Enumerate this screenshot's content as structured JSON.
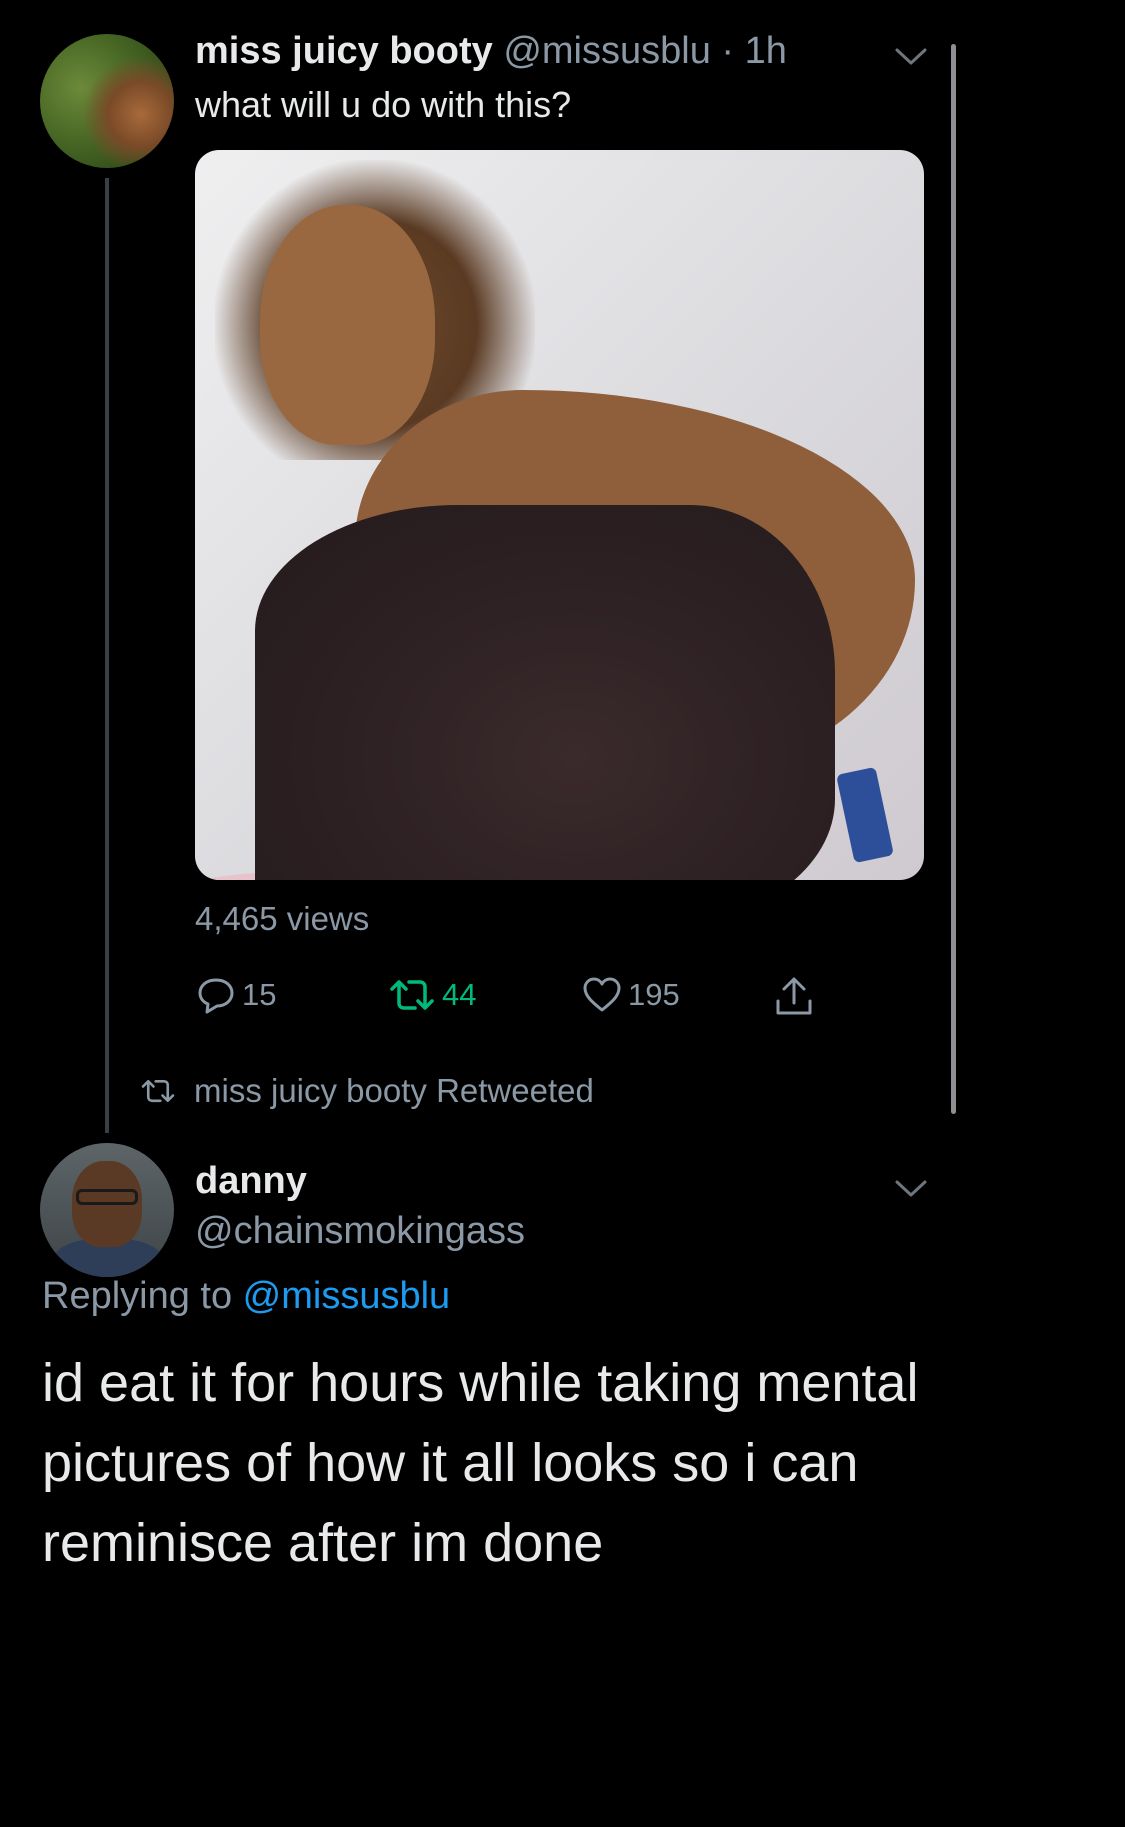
{
  "tweet": {
    "author_name": "miss juicy booty",
    "author_handle": "@missusblu",
    "separator": " · ",
    "time": "1h",
    "text": "what will u do with this?",
    "views": "4,465 views",
    "replies": "15",
    "retweets": "44",
    "likes": "195"
  },
  "retweet_notice": {
    "text": "miss juicy booty Retweeted"
  },
  "reply": {
    "author_name": "danny",
    "author_handle": "@chainsmokingass",
    "replying_prefix": "Replying to ",
    "replying_handle": "@missusblu",
    "text": "id eat it for hours while taking mental pictures of how it all looks so i can reminisce after im done"
  },
  "icons": {
    "more": "chevron-down-icon",
    "reply": "comment-bubble-icon",
    "retweet": "retweet-icon",
    "like": "heart-icon",
    "share": "share-upload-icon"
  },
  "colors": {
    "background": "#000000",
    "text": "#e7e9ea",
    "muted": "#8b98a5",
    "link": "#1d9bf0",
    "retweet_active": "#00ba7c"
  }
}
